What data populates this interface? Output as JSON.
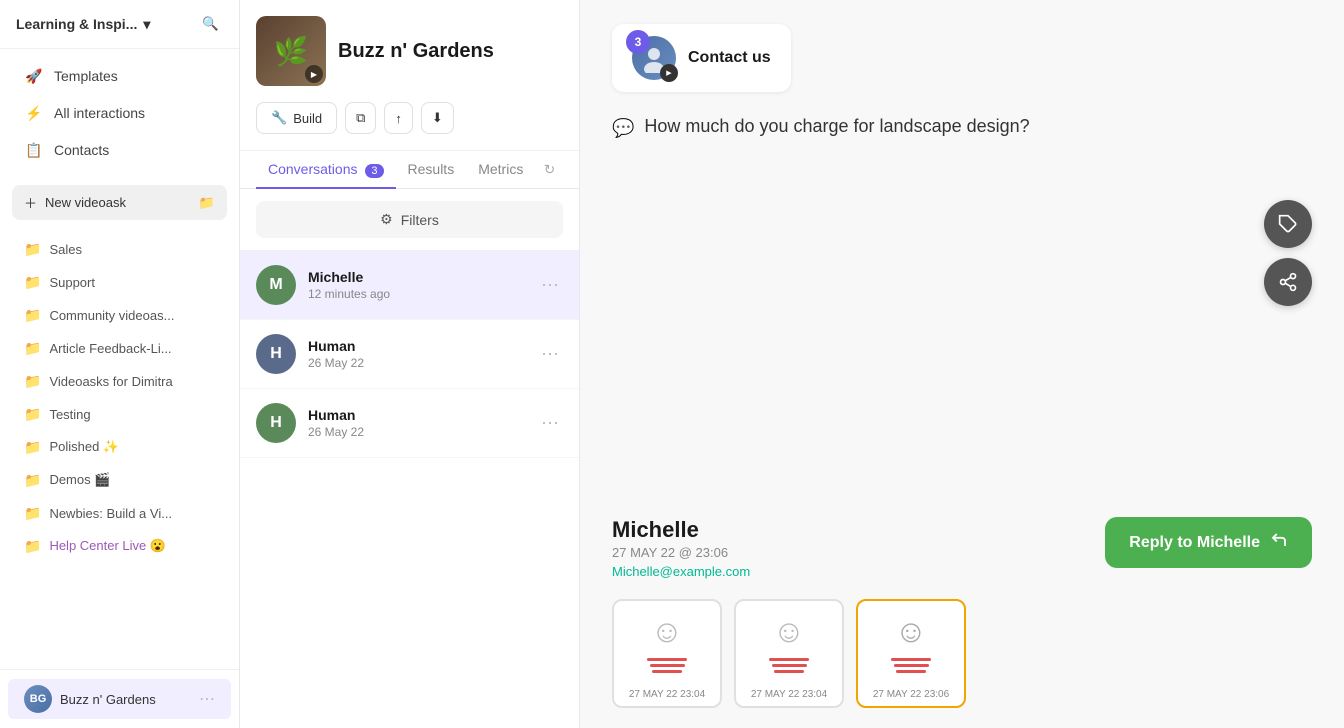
{
  "app": {
    "workspace": "Learning & Inspi...",
    "workspace_chevron": "▾"
  },
  "sidebar": {
    "nav": [
      {
        "id": "templates",
        "label": "Templates",
        "icon": "🚀"
      },
      {
        "id": "all-interactions",
        "label": "All interactions",
        "icon": "⚡"
      },
      {
        "id": "contacts",
        "label": "Contacts",
        "icon": "📋"
      }
    ],
    "new_button": "New videoask",
    "folders": [
      {
        "id": "sales",
        "label": "Sales",
        "icon": "📁",
        "color": "default"
      },
      {
        "id": "support",
        "label": "Support",
        "icon": "📁",
        "color": "default"
      },
      {
        "id": "community",
        "label": "Community videoas...",
        "icon": "📁",
        "color": "default"
      },
      {
        "id": "article-feedback",
        "label": "Article Feedback-Li...",
        "icon": "📁",
        "color": "default"
      },
      {
        "id": "videoasks-dimitra",
        "label": "Videoasks for Dimitra",
        "icon": "📁",
        "color": "default"
      },
      {
        "id": "testing",
        "label": "Testing",
        "icon": "📁",
        "color": "default"
      },
      {
        "id": "polished",
        "label": "Polished ✨",
        "icon": "📁",
        "color": "default"
      },
      {
        "id": "demos",
        "label": "Demos 🎬",
        "icon": "📁",
        "color": "default"
      },
      {
        "id": "newbies",
        "label": "Newbies: Build a Vi...",
        "icon": "📁",
        "color": "default"
      },
      {
        "id": "help-center",
        "label": "Help Center Live 😮",
        "icon": "📁",
        "color": "purple"
      }
    ],
    "bottom_items": [
      {
        "id": "buzz-gardens",
        "label": "Buzz n' Gardens",
        "active": true
      },
      {
        "id": "user2",
        "label": "..."
      }
    ]
  },
  "middle": {
    "bot_name": "Buzz n' Gardens",
    "actions": {
      "build": "Build",
      "duplicate": "⧉",
      "share": "↑",
      "download": "⬇"
    },
    "tabs": [
      {
        "id": "conversations",
        "label": "Conversations",
        "count": 3,
        "active": true
      },
      {
        "id": "results",
        "label": "Results",
        "count": null,
        "active": false
      },
      {
        "id": "metrics",
        "label": "Metrics",
        "count": null,
        "active": false
      }
    ],
    "filters_label": "Filters",
    "conversations": [
      {
        "id": "michelle",
        "name": "Michelle",
        "time": "12 minutes ago",
        "avatar_color": "#5a8a5a",
        "initials": "M",
        "active": true
      },
      {
        "id": "human1",
        "name": "Human",
        "time": "26 May 22",
        "avatar_color": "#5a6a7a",
        "initials": "H",
        "active": false
      },
      {
        "id": "human2",
        "name": "Human",
        "time": "26 May 22",
        "avatar_color": "#5a8a5a",
        "initials": "H",
        "active": false
      }
    ]
  },
  "main": {
    "contact_banner": {
      "badge": "3",
      "label": "Contact us"
    },
    "message": "How much do you charge for landscape design?",
    "contact": {
      "name": "Michelle",
      "date": "27 MAY 22 @ 23:06",
      "email": "Michelle@example.com"
    },
    "reply_button": "Reply to Michelle",
    "thumbnails": [
      {
        "id": "thumb1",
        "date": "27 MAY 22",
        "time": "23:04",
        "selected": false
      },
      {
        "id": "thumb2",
        "date": "27 MAY 22",
        "time": "23:04",
        "selected": false
      },
      {
        "id": "thumb3",
        "date": "27 MAY 22",
        "time": "23:06",
        "selected": true
      }
    ]
  }
}
